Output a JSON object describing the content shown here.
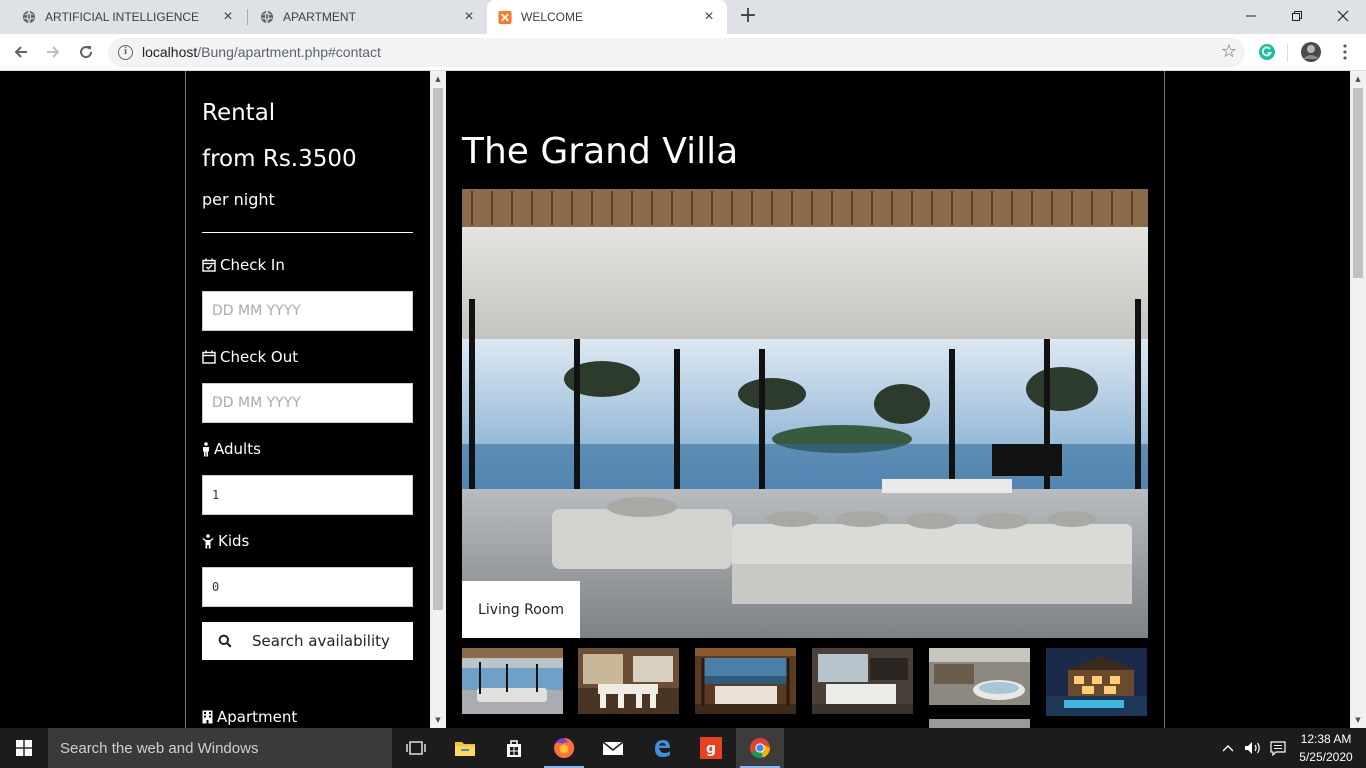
{
  "browser": {
    "tabs": [
      {
        "label": "ARTIFICIAL INTELLIGENCE",
        "icon": "globe-icon"
      },
      {
        "label": "APARTMENT",
        "icon": "globe-icon"
      },
      {
        "label": "WELCOME",
        "icon": "xampp-icon",
        "active": true
      }
    ],
    "url_host": "localhost",
    "url_path": "/Bung/apartment.php#contact"
  },
  "sidebar": {
    "rental_label": "Rental",
    "price_label": "from Rs.3500",
    "per_label": "per night",
    "checkin_label": "Check In",
    "checkin_placeholder": "DD MM YYYY",
    "checkout_label": "Check Out",
    "checkout_placeholder": "DD MM YYYY",
    "adults_label": "Adults",
    "adults_value": "1",
    "kids_label": "Kids",
    "kids_value": "0",
    "search_label": "Search availability",
    "apartment_label": "Apartment"
  },
  "main": {
    "title": "The Grand Villa",
    "caption": "Living Room",
    "thumbnails": [
      "living-room",
      "kitchen-dining",
      "bedroom-view",
      "bedroom",
      "bathroom",
      "exterior-pool"
    ]
  },
  "taskbar": {
    "search_placeholder": "Search the web and Windows",
    "time": "12:38 AM",
    "date": "5/25/2020"
  },
  "colors": {
    "page_bg": "#000000",
    "accent": "#ffffff"
  }
}
